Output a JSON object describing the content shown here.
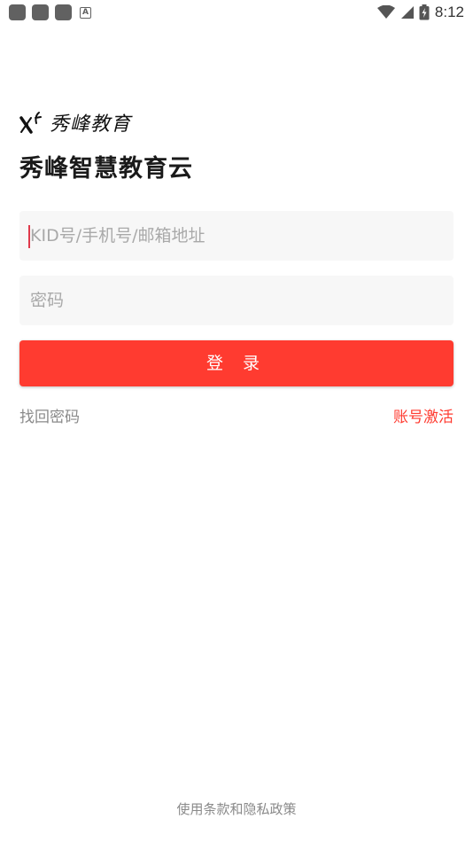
{
  "status_bar": {
    "time": "8:12",
    "icons": [
      "notification-icon",
      "notification-icon",
      "notification-icon",
      "keyboard-a-icon",
      "wifi-icon",
      "cell-signal-icon",
      "battery-icon"
    ]
  },
  "logo": {
    "brand_text": "秀峰教育"
  },
  "app_title": "秀峰智慧教育云",
  "login_form": {
    "account_placeholder": "KID号/手机号/邮箱地址",
    "account_value": "",
    "password_placeholder": "密码",
    "password_value": "",
    "login_label": "登 录",
    "forgot_password_label": "找回密码",
    "activate_account_label": "账号激活"
  },
  "footer": {
    "terms_label": "使用条款和隐私政策"
  },
  "colors": {
    "accent": "#ff3b30",
    "field_bg": "#f7f7f7",
    "muted_text": "#8a8a8a"
  }
}
